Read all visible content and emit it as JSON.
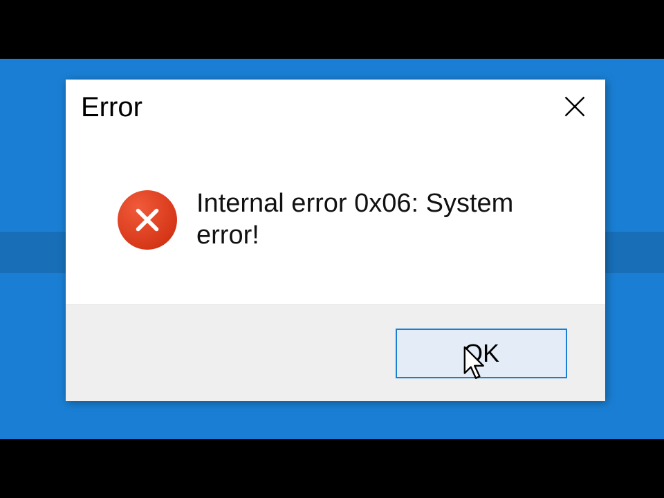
{
  "dialog": {
    "title": "Error",
    "message": "Internal error 0x06: System error!",
    "ok_label": "OK",
    "icon": "error-circle-x",
    "colors": {
      "error_icon": "#d63818",
      "accent": "#1a7fd4",
      "button_bg": "#e4ecf7",
      "footer_bg": "#efefef"
    }
  }
}
